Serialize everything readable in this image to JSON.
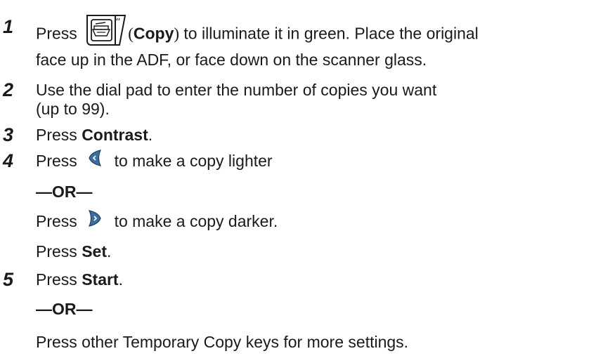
{
  "steps": [
    {
      "number": "1",
      "line1_a": "Press",
      "key_label_open": "(",
      "key_label": "Copy",
      "key_label_close": ")",
      "line1_b": " to illuminate it in green. Place the original",
      "line2": "face up in the ADF, or face down on the scanner glass.",
      "key_icon": "copy-key-icon"
    },
    {
      "number": "2",
      "line1": "Use the dial pad to enter the number of copies you want",
      "line2": "(up to 99)."
    },
    {
      "number": "3",
      "pre": "Press ",
      "bold": "Contrast",
      "post": "."
    },
    {
      "number": "4",
      "line1_a": "Press",
      "line1_b": "to make a copy lighter",
      "or": "—OR—",
      "line3_a": "Press",
      "line3_b": "to make a copy darker.",
      "line4_pre": "Press ",
      "line4_bold": "Set",
      "line4_post": ".",
      "left_icon": "left-arrow-key-icon",
      "right_icon": "right-arrow-key-icon"
    },
    {
      "number": "5",
      "pre": "Press ",
      "bold": "Start",
      "post": ".",
      "or": "—OR—",
      "line3": "Press other Temporary Copy keys for more settings."
    }
  ],
  "colors": {
    "text": "#1a1a1a",
    "arrow_key": "#3d6ea0",
    "arrow_key_edge": "#1f3f5e"
  }
}
